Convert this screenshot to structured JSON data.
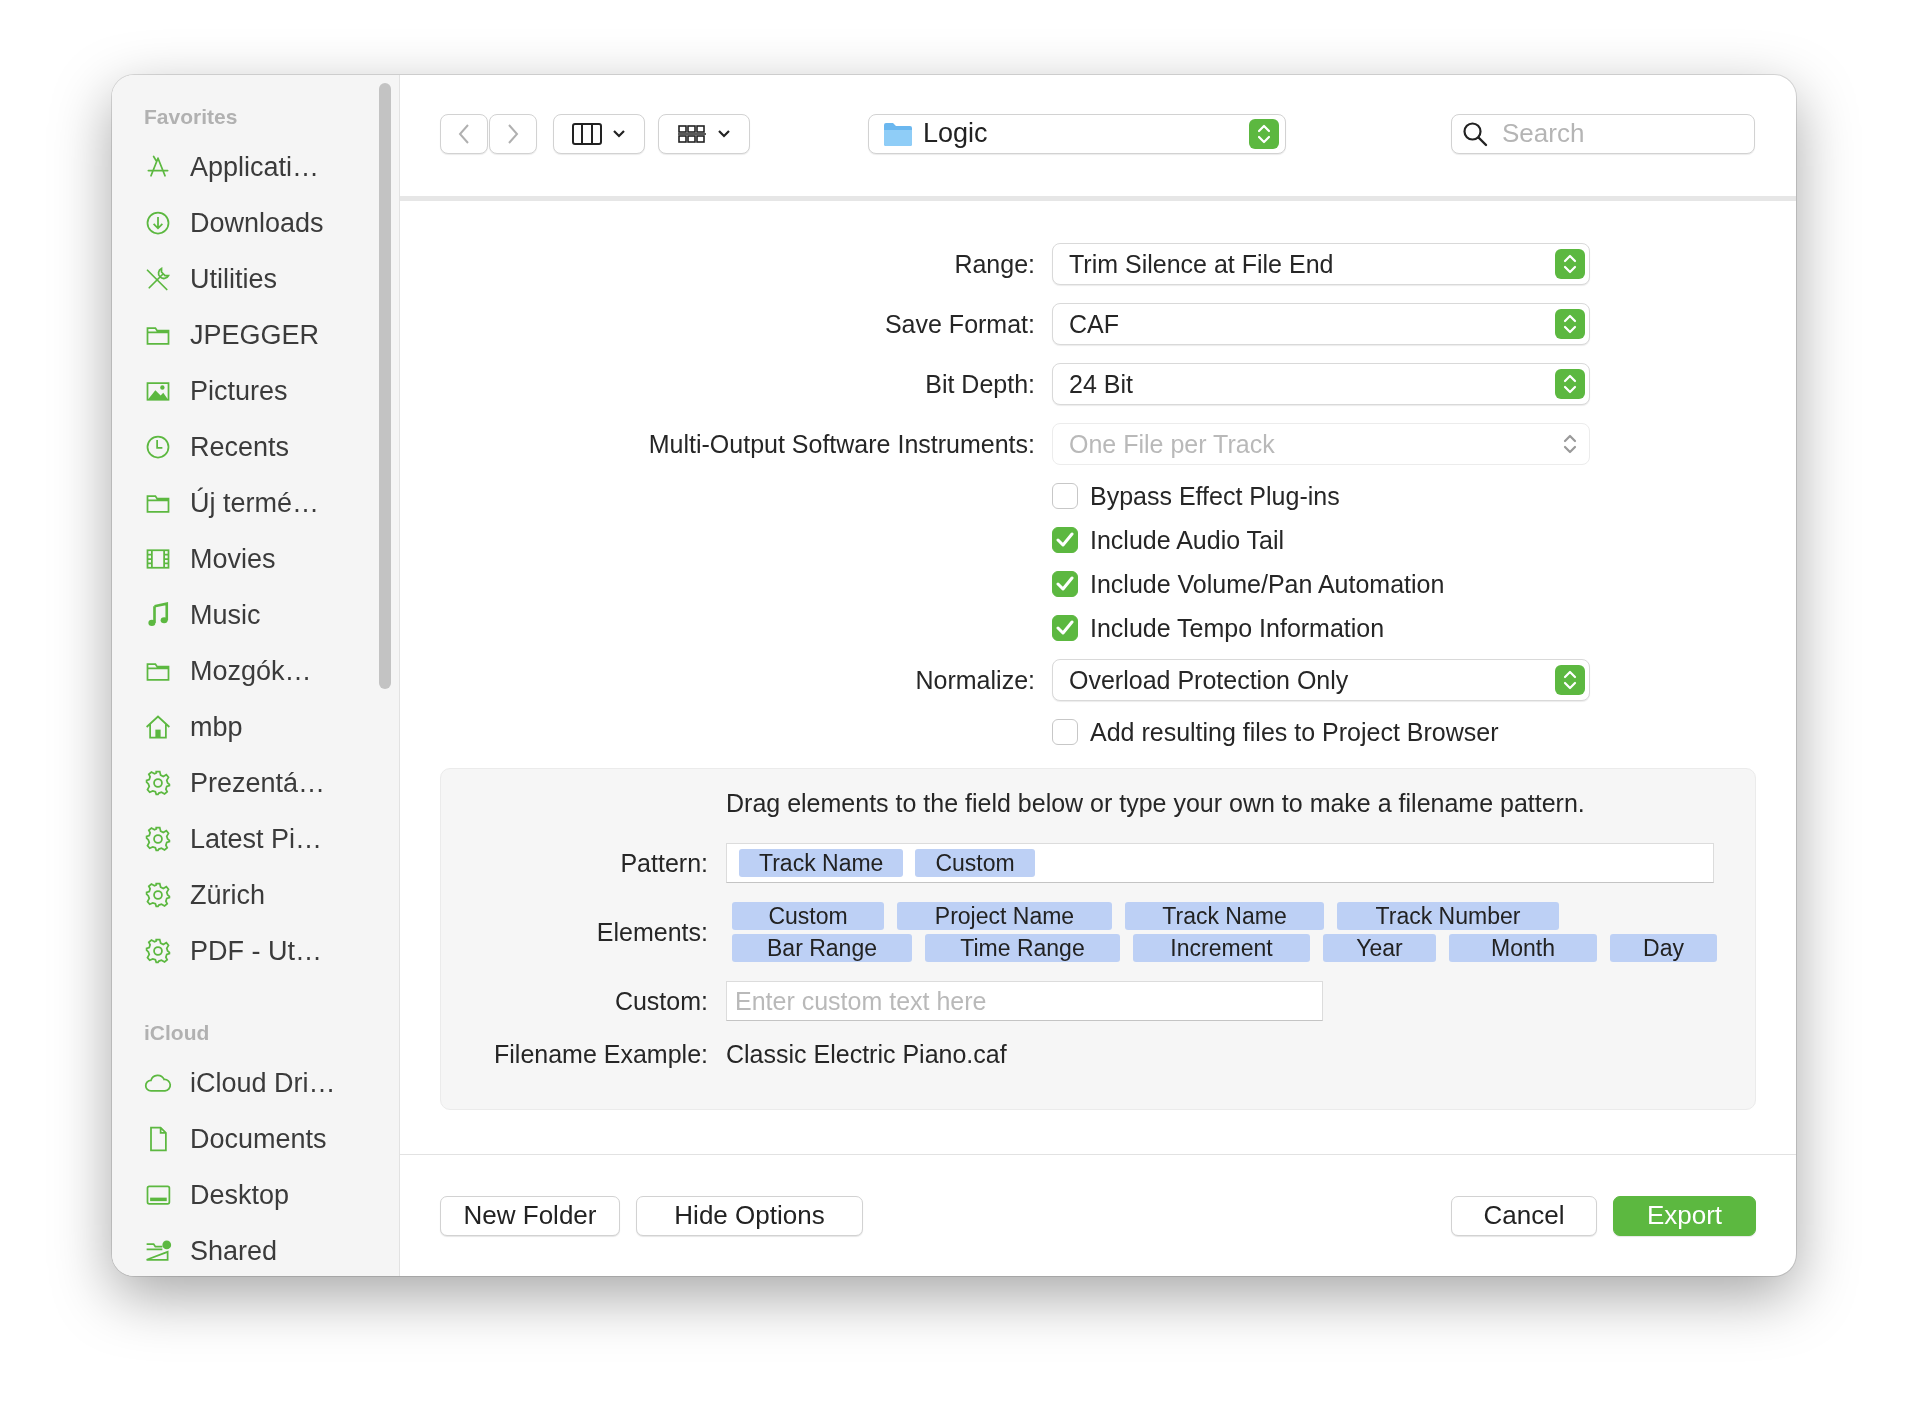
{
  "sidebar": {
    "sections": [
      {
        "title": "Favorites",
        "items": [
          {
            "label": "Applicati…",
            "kind": "apps"
          },
          {
            "label": "Downloads",
            "kind": "download"
          },
          {
            "label": "Utilities",
            "kind": "tools"
          },
          {
            "label": "JPEGGER",
            "kind": "folder"
          },
          {
            "label": "Pictures",
            "kind": "photo"
          },
          {
            "label": "Recents",
            "kind": "clock"
          },
          {
            "label": "Új termé…",
            "kind": "folder"
          },
          {
            "label": "Movies",
            "kind": "film"
          },
          {
            "label": "Music",
            "kind": "music"
          },
          {
            "label": "Mozgók…",
            "kind": "folder"
          },
          {
            "label": "mbp",
            "kind": "home"
          },
          {
            "label": "Prezentá…",
            "kind": "gear"
          },
          {
            "label": "Latest Pi…",
            "kind": "gear"
          },
          {
            "label": "Zürich",
            "kind": "gear"
          },
          {
            "label": "PDF - Ut…",
            "kind": "gear"
          }
        ]
      },
      {
        "title": "iCloud",
        "items": [
          {
            "label": "iCloud Dri…",
            "kind": "cloud"
          },
          {
            "label": "Documents",
            "kind": "doc"
          },
          {
            "label": "Desktop",
            "kind": "desktop"
          },
          {
            "label": "Shared",
            "kind": "shared"
          }
        ]
      }
    ]
  },
  "toolbar": {
    "location": "Logic",
    "search": {
      "placeholder": "Search"
    }
  },
  "options": [
    {
      "kind": "popup",
      "label": "Range:",
      "value": "Trim Silence at File End",
      "disabled": false
    },
    {
      "kind": "popup",
      "label": "Save Format:",
      "value": "CAF",
      "disabled": false
    },
    {
      "kind": "popup",
      "label": "Bit Depth:",
      "value": "24 Bit",
      "disabled": false
    },
    {
      "kind": "popup",
      "label": "Multi-Output Software Instruments:",
      "value": "One File per Track",
      "disabled": true
    },
    {
      "kind": "checkbox",
      "label": "Bypass Effect Plug-ins",
      "checked": false
    },
    {
      "kind": "checkbox",
      "label": "Include Audio Tail",
      "checked": true
    },
    {
      "kind": "checkbox",
      "label": "Include Volume/Pan Automation",
      "checked": true
    },
    {
      "kind": "checkbox",
      "label": "Include Tempo Information",
      "checked": true
    },
    {
      "kind": "popup",
      "label": "Normalize:",
      "value": "Overload Protection Only",
      "disabled": false
    },
    {
      "kind": "checkbox",
      "label": "Add resulting files to Project Browser",
      "checked": false
    }
  ],
  "naming": {
    "hint": "Drag elements to the field below or type your own to make a filename pattern.",
    "pattern_label": "Pattern:",
    "pattern": [
      "Track Name",
      "Custom"
    ],
    "elements_label": "Elements:",
    "elements": [
      [
        "Custom",
        "Project Name",
        "Track Name",
        "Track Number"
      ],
      [
        "Bar Range",
        "Time Range",
        "Increment",
        "Year",
        "Month",
        "Day"
      ]
    ],
    "custom_label": "Custom:",
    "custom_placeholder": "Enter custom text here",
    "example_label": "Filename Example:",
    "example": "Classic Electric Piano.caf"
  },
  "buttons": [
    {
      "label": "New Folder",
      "kind": "plain"
    },
    {
      "label": "Hide Options",
      "kind": "plain"
    },
    {
      "label": "Cancel",
      "kind": "plain"
    },
    {
      "label": "Export",
      "kind": "default"
    }
  ]
}
